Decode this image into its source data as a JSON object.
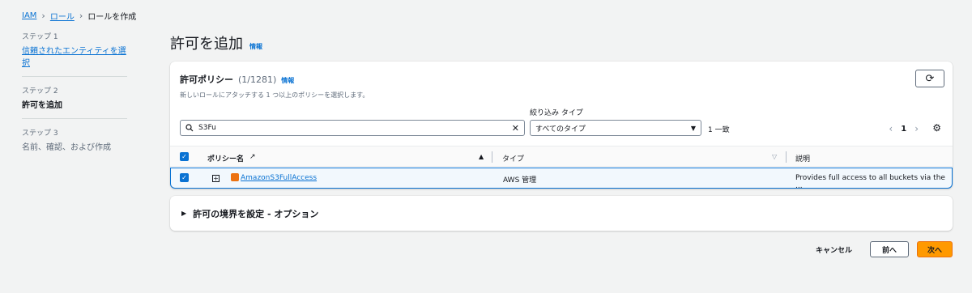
{
  "breadcrumb": {
    "iam": "IAM",
    "roles": "ロール",
    "current": "ロールを作成",
    "sep": "›"
  },
  "steps": [
    {
      "num": "ステップ 1",
      "name": "信頼されたエンティティを選択"
    },
    {
      "num": "ステップ 2",
      "name": "許可を追加"
    },
    {
      "num": "ステップ 3",
      "name": "名前、確認、および作成"
    }
  ],
  "page": {
    "title": "許可を追加",
    "info": "情報"
  },
  "panel": {
    "title": "許可ポリシー",
    "count": "(1/1281)",
    "info": "情報",
    "description": "新しいロールにアタッチする 1 つ以上のポリシーを選択します。",
    "refresh_icon": "refresh-icon"
  },
  "filter": {
    "search_value": "S3Fu",
    "search_icon": "search-icon",
    "type_label": "絞り込み タイプ",
    "type_value": "すべてのタイプ",
    "match_text": "1 一致"
  },
  "pager": {
    "current_page": "1"
  },
  "table": {
    "headers": {
      "name": "ポリシー名",
      "type": "タイプ",
      "description": "説明"
    },
    "rows": [
      {
        "name": "AmazonS3FullAccess",
        "type": "AWS 管理",
        "description": "Provides full access to all buckets via the ..."
      }
    ]
  },
  "options": {
    "label": "許可の境界を設定 - オプション"
  },
  "footer": {
    "cancel": "キャンセル",
    "previous": "前へ",
    "next": "次へ"
  },
  "colors": {
    "accent": "#0972d3",
    "primary_button": "#ff9900",
    "background": "#f2f3f3"
  }
}
